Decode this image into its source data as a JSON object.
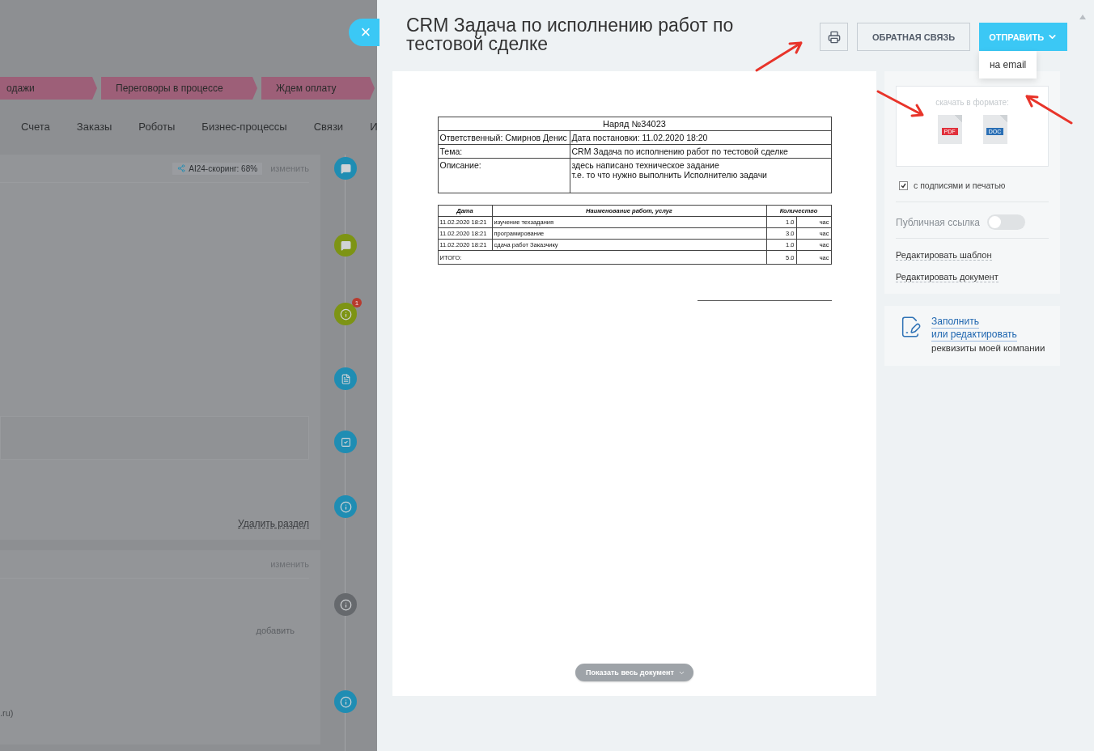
{
  "background_page": {
    "stages": [
      "одажи",
      "Переговоры в процессе",
      "Ждем оплату"
    ],
    "tabs": [
      "Счета",
      "Заказы",
      "Роботы",
      "Бизнес-процессы",
      "Связи",
      "И"
    ],
    "scoring": "AI24-скоринг: 68%",
    "card_edit_link": "изменить",
    "delete_section_link": "Удалить раздел",
    "second_card": {
      "edit_link": "изменить",
      "add_link": "добавить",
      "footer_text": ".ru)"
    },
    "timeline": [
      {
        "kind": "comment",
        "color": "#1f8db3"
      },
      {
        "kind": "comment",
        "color": "#7d9414"
      },
      {
        "kind": "info",
        "color": "#7d9414",
        "badge": "1"
      },
      {
        "kind": "document",
        "color": "#1f8db3"
      },
      {
        "kind": "task",
        "color": "#1f8db3"
      },
      {
        "kind": "info",
        "color": "#1f8db3"
      },
      {
        "kind": "info",
        "color": "#66696d"
      },
      {
        "kind": "info",
        "color": "#1f8db3"
      }
    ]
  },
  "close_button": "×",
  "panel": {
    "title": "CRM Задача по исполнению работ по тестовой сделке",
    "feedback_button": "ОБРАТНАЯ СВЯЗЬ",
    "send_button": "ОТПРАВИТЬ",
    "send_menu": {
      "expanded": true,
      "items": [
        "на email"
      ]
    },
    "document": {
      "title": "Наряд №34023",
      "responsible": "Ответственный: Смирнов Денис",
      "date_set": "Дата постановки: 11.02.2020 18:20",
      "fields": [
        {
          "label": "Тема:",
          "value": "CRM Задача по исполнению работ по тестовой сделке"
        },
        {
          "label": "Описание:",
          "value": "здесь написано техническое задание\nт.е. то что нужно выполнить Исполнителю задачи"
        }
      ],
      "works": {
        "columns": [
          "Дата",
          "Наименование работ, услуг",
          "Количество"
        ],
        "rows": [
          {
            "date": "11.02.2020 18:21",
            "name": "изучение техзадания",
            "qty": "1.0",
            "unit": "час"
          },
          {
            "date": "11.02.2020 18:21",
            "name": "програмирование",
            "qty": "3.0",
            "unit": "час"
          },
          {
            "date": "11.02.2020 18:21",
            "name": "сдача работ Заказчику",
            "qty": "1.0",
            "unit": "час"
          }
        ],
        "total": {
          "label": "ИТОГО:",
          "qty": "5.0",
          "unit": "час"
        }
      },
      "show_all_button": "Показать весь документ"
    },
    "sidebar": {
      "download": {
        "label": "скачать в формате:",
        "formats": [
          {
            "label": "PDF",
            "color": "#e0313c"
          },
          {
            "label": "DOC",
            "color": "#2a6fb5"
          }
        ]
      },
      "signatures": {
        "label": "с подписями и печатью",
        "checked": true
      },
      "public_link": {
        "label": "Публичная ссылка",
        "on": false
      },
      "links": [
        "Редактировать шаблон",
        "Редактировать документ"
      ],
      "company": {
        "link_lines": [
          "Заполнить",
          "или редактировать"
        ],
        "text": "реквизиты моей компании"
      }
    }
  }
}
